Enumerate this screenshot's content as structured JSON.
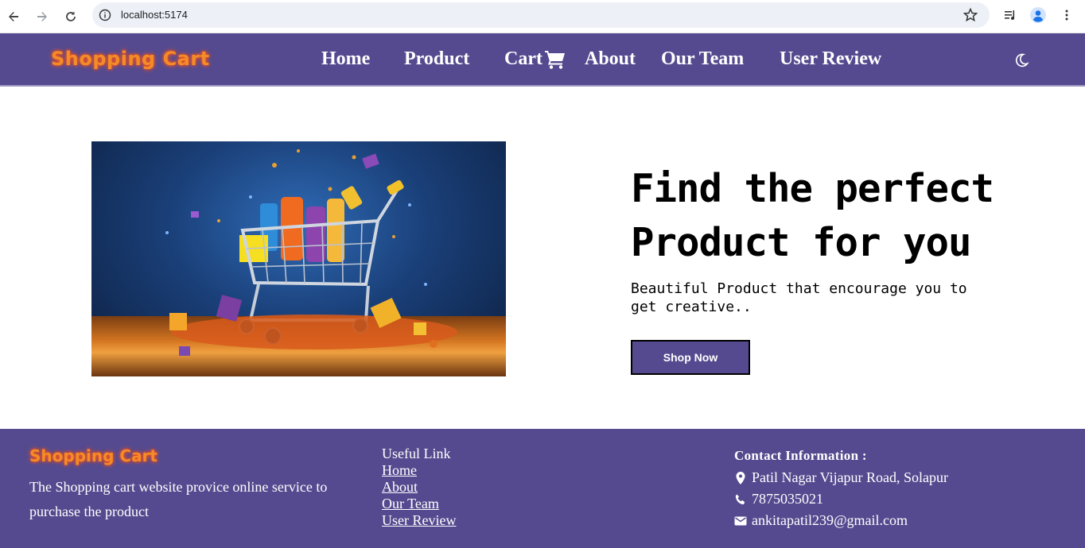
{
  "browser": {
    "url": "localhost:5174"
  },
  "header": {
    "brand": "Shopping Cart",
    "menu": {
      "home": "Home",
      "product": "Product",
      "cart": "Cart",
      "about": "About",
      "team": "Our Team",
      "review": "User Review"
    },
    "icons": [
      "cart-icon",
      "moon-icon"
    ]
  },
  "hero": {
    "title_line1": "Find the perfect",
    "title_line2": "Product for you",
    "subtitle": "Beautiful Product that encourage you to get creative..",
    "button": "Shop Now"
  },
  "footer": {
    "brand": "Shopping Cart",
    "description": "The Shopping cart website provice online service to purchase the product",
    "links_title": "Useful Link",
    "links": {
      "home": "Home",
      "about": "About",
      "team": "Our Team",
      "review": "User Review"
    },
    "contact_title": "Contact Information :",
    "address": "Patil Nagar Vijapur Road, Solapur",
    "phone": "7875035021",
    "email": "ankitapatil239@gmail.com"
  },
  "colors": {
    "brand_purple": "#554a8f",
    "brand_orange": "#f28c28"
  }
}
